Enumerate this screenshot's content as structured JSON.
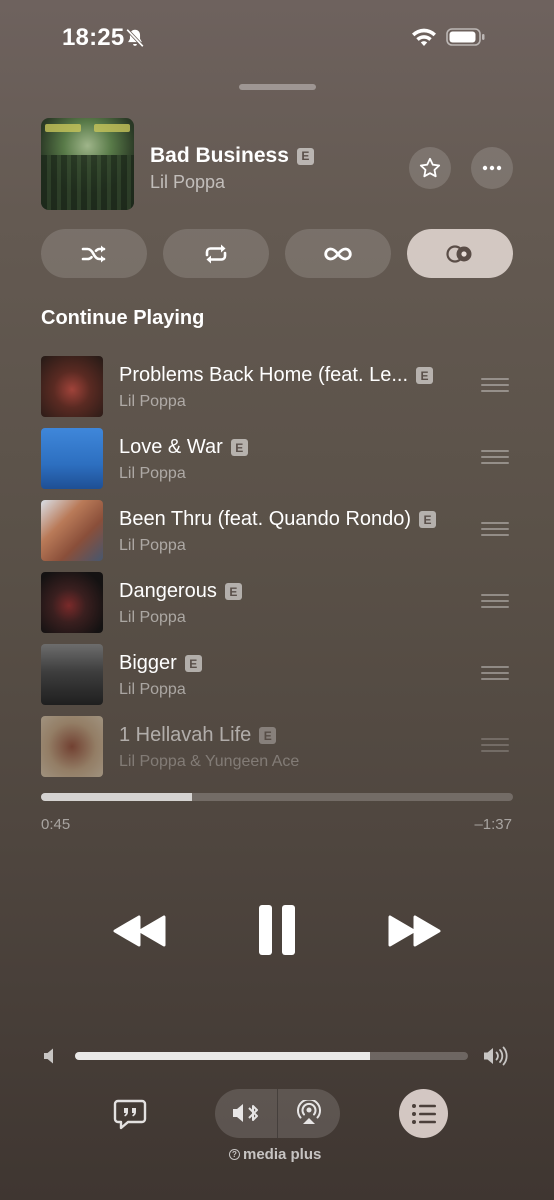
{
  "status_bar": {
    "time": "18:25",
    "icons": [
      "bell-slash-icon",
      "wifi-icon",
      "battery-icon"
    ]
  },
  "now_playing": {
    "title": "Bad Business",
    "explicit": "E",
    "artist": "Lil Poppa",
    "icons": [
      "star-icon",
      "more-icon"
    ]
  },
  "modes": [
    {
      "name": "shuffle",
      "icon": "shuffle-icon",
      "active": false
    },
    {
      "name": "repeat",
      "icon": "repeat-icon",
      "active": false
    },
    {
      "name": "infinity",
      "icon": "infinity-icon",
      "active": false
    },
    {
      "name": "crossfade",
      "icon": "crossfade-icon",
      "active": true
    }
  ],
  "section_title": "Continue Playing",
  "queue": [
    {
      "title": "Problems Back Home (feat. Le...",
      "explicit": "E",
      "artist": "Lil Poppa",
      "art_color": "#3a2a22"
    },
    {
      "title": "Love & War",
      "explicit": "E",
      "artist": "Lil Poppa",
      "art_color": "#2f6fc4"
    },
    {
      "title": "Been Thru (feat. Quando Rondo)",
      "explicit": "E",
      "artist": "Lil Poppa",
      "art_color": "#b36b4a"
    },
    {
      "title": "Dangerous",
      "explicit": "E",
      "artist": "Lil Poppa",
      "art_color": "#1e1a1a"
    },
    {
      "title": "Bigger",
      "explicit": "E",
      "artist": "Lil Poppa",
      "art_color": "#2b2b2b"
    },
    {
      "title": "1 Hellavah Life",
      "explicit": "E",
      "artist": "Lil Poppa & Yungeen Ace",
      "art_color": "#c9a983"
    }
  ],
  "playback": {
    "elapsed": "0:45",
    "remaining": "–1:37",
    "progress_fraction": 0.32
  },
  "transport_icons": [
    "rewind-icon",
    "pause-icon",
    "fast-forward-icon"
  ],
  "volume": {
    "level_fraction": 0.75
  },
  "bottom": {
    "media_label": "media plus",
    "icons": [
      "lyrics-icon",
      "bluetooth-speaker-icon",
      "airplay-icon",
      "queue-list-icon"
    ]
  }
}
